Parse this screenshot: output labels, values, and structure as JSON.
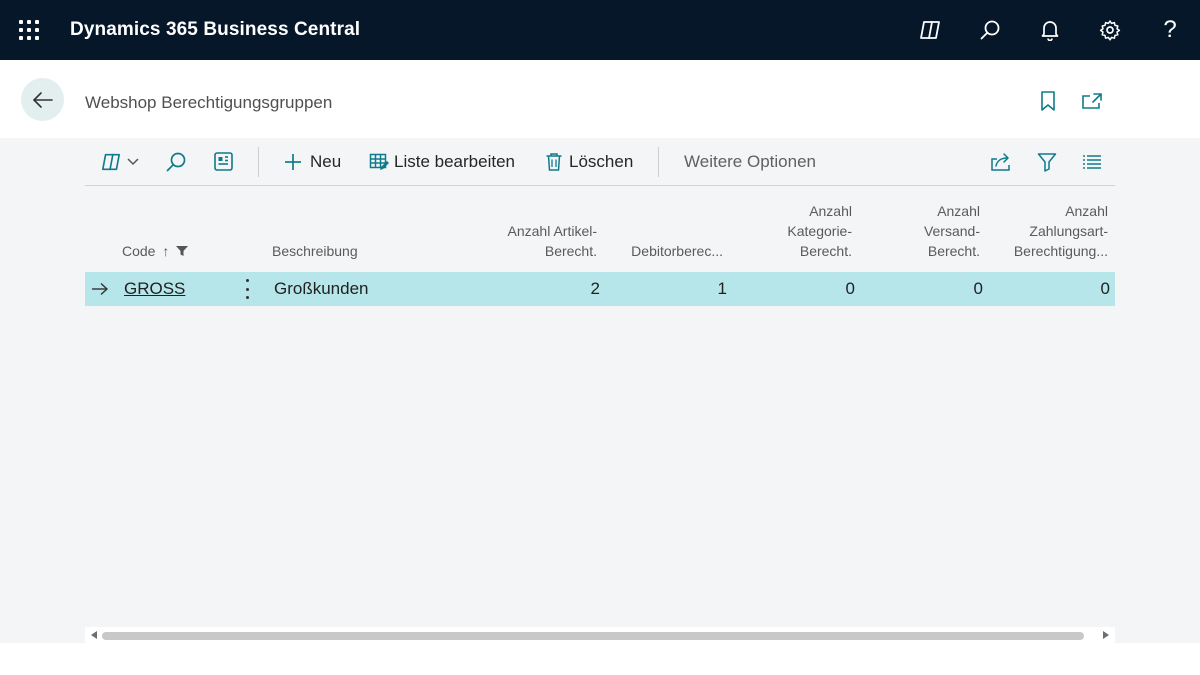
{
  "app": {
    "title": "Dynamics 365 Business Central",
    "icons": [
      "app-launcher-icon",
      "copilot-icon",
      "search-icon",
      "bell-icon",
      "gear-icon",
      "help-icon"
    ],
    "help_label": "?"
  },
  "header": {
    "title": "Webshop Berechtigungsgruppen",
    "icons": [
      "back-arrow-icon",
      "bookmark-icon",
      "open-new-window-icon"
    ]
  },
  "toolbar": {
    "new_label": "Neu",
    "edit_list_label": "Liste bearbeiten",
    "delete_label": "Löschen",
    "more_label": "Weitere Optionen",
    "icons": [
      "copilot-icon",
      "search-icon",
      "analysis-icon",
      "plus-icon",
      "edit-list-icon",
      "trash-icon",
      "share-icon",
      "filter-icon",
      "list-icon"
    ]
  },
  "table": {
    "columns": [
      {
        "line1": "",
        "line2": "",
        "line3": "Code"
      },
      {
        "line1": "",
        "line2": "",
        "line3": "Beschreibung"
      },
      {
        "line1": "",
        "line2": "Anzahl Artikel-",
        "line3": "Berecht."
      },
      {
        "line1": "",
        "line2": "",
        "line3": "Debitorberec..."
      },
      {
        "line1": "Anzahl",
        "line2": "Kategorie-",
        "line3": "Berecht."
      },
      {
        "line1": "Anzahl",
        "line2": "Versand-",
        "line3": "Berecht."
      },
      {
        "line1": "Anzahl",
        "line2": "Zahlungsart-",
        "line3": "Berechtigung..."
      }
    ],
    "sort_indicator": "↑",
    "rows": [
      {
        "code": "GROSS",
        "beschreibung": "Großkunden",
        "artikel": "2",
        "debitor": "1",
        "kategorie": "0",
        "versand": "0",
        "zahlungsart": "0"
      }
    ]
  },
  "colors": {
    "topbar": "#06172a",
    "selected_row": "#b6e6ea",
    "content_bg": "#f4f5f7"
  }
}
